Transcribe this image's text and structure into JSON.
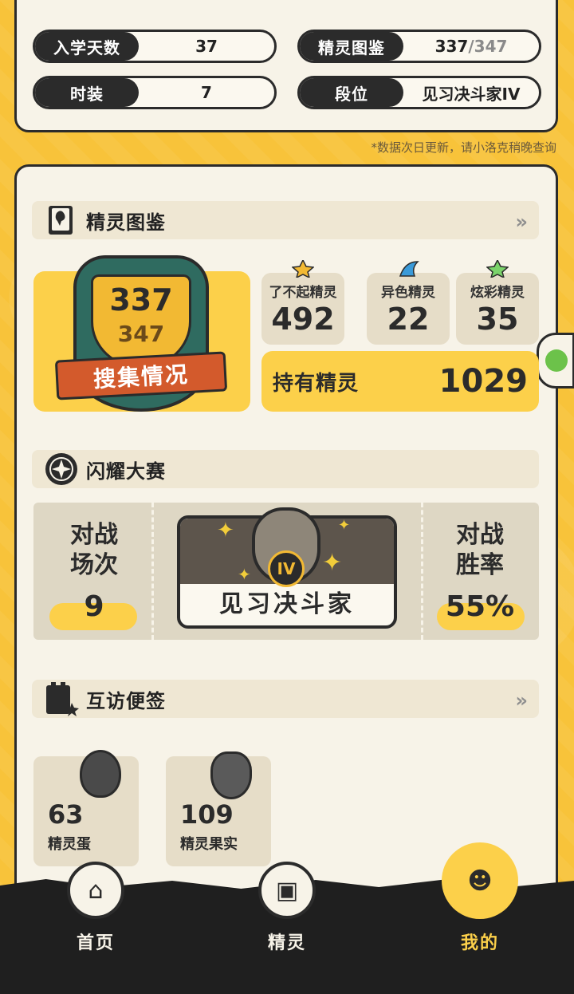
{
  "stats": [
    {
      "label": "入学天数",
      "value": "37"
    },
    {
      "label": "精灵图鉴",
      "value": "337",
      "value_suffix": "/347"
    },
    {
      "label": "时装",
      "value": "7"
    },
    {
      "label": "段位",
      "value": "见习决斗家IV"
    }
  ],
  "note": "*数据次日更新，请小洛克稍晚查询",
  "sections": {
    "pokedex": {
      "title": "精灵图鉴",
      "more_icon": "double-chevron-right-icon"
    },
    "contest": {
      "title": "闪耀大赛"
    },
    "visit": {
      "title": "互访便签",
      "more_icon": "double-chevron-right-icon"
    }
  },
  "collection": {
    "collected": "337",
    "total": "347",
    "ribbon_label": "搜集情况"
  },
  "mini_cards": [
    {
      "label": "了不起精灵",
      "value": "492",
      "icon": "star-icon"
    },
    {
      "label": "异色精灵",
      "value": "22",
      "icon": "fin-icon"
    },
    {
      "label": "炫彩精灵",
      "value": "35",
      "icon": "rainbow-star-icon"
    }
  ],
  "owned": {
    "label": "持有精灵",
    "value": "1029"
  },
  "battle": {
    "matches_label_line1": "对战",
    "matches_label_line2": "场次",
    "matches_value": "9",
    "winrate_label_line1": "对战",
    "winrate_label_line2": "胜率",
    "winrate_value": "55%",
    "rank_badge_level": "IV",
    "rank_title": "见习决斗家"
  },
  "visit_items": [
    {
      "value": "63",
      "label": "精灵蛋",
      "icon": "egg-icon"
    },
    {
      "value": "109",
      "label": "精灵果实",
      "icon": "acorn-icon"
    }
  ],
  "nav": [
    {
      "label": "首页",
      "icon": "home-icon",
      "active": false
    },
    {
      "label": "精灵",
      "icon": "backpack-icon",
      "active": false
    },
    {
      "label": "我的",
      "icon": "profile-icon",
      "active": true
    }
  ],
  "colors": {
    "accent": "#fcd04a",
    "dark": "#2b2b2b",
    "card": "#f7f3e8",
    "background": "#f8c33a"
  }
}
